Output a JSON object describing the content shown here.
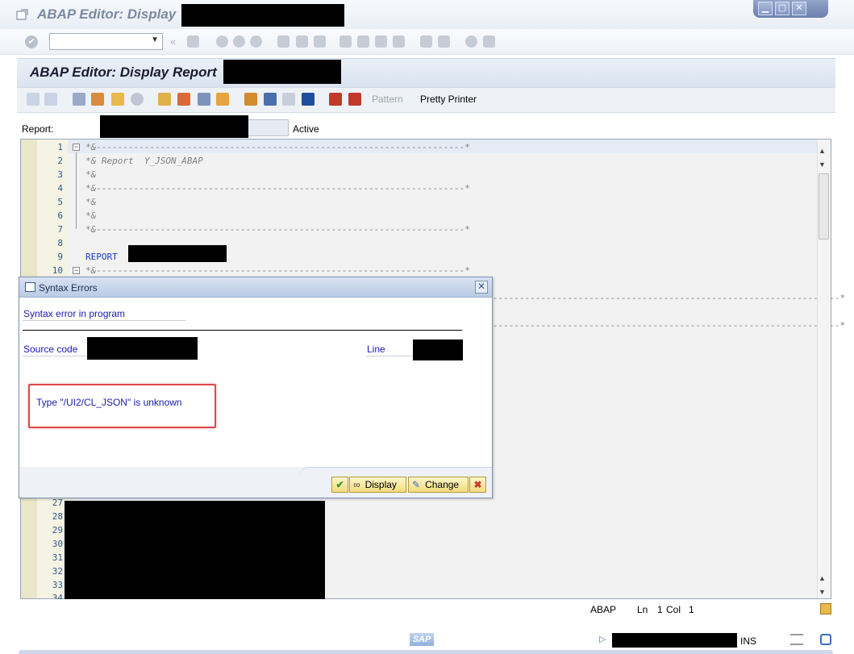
{
  "window": {
    "title": "ABAP Editor: Display",
    "buttons": [
      "▁",
      "▢",
      "✕"
    ]
  },
  "system_toolbar": {
    "command_field_value": ""
  },
  "screen": {
    "title": "ABAP Editor: Display Report"
  },
  "app_toolbar": {
    "pattern_label": "Pattern",
    "pretty_printer_label": "Pretty Printer"
  },
  "report_row": {
    "label": "Report:",
    "status": "Active"
  },
  "editor": {
    "lines": [
      {
        "num": "1",
        "text": "*&---------------------------------------------------------------------*"
      },
      {
        "num": "2",
        "text": "*& Report  Y_JSON_ABAP"
      },
      {
        "num": "3",
        "text": "*&"
      },
      {
        "num": "4",
        "text": "*&---------------------------------------------------------------------*"
      },
      {
        "num": "5",
        "text": "*&"
      },
      {
        "num": "6",
        "text": "*&"
      },
      {
        "num": "7",
        "text": "*&---------------------------------------------------------------------*"
      },
      {
        "num": "8",
        "text": ""
      },
      {
        "num": "9",
        "text": "REPORT"
      },
      {
        "num": "10",
        "text": "*&---------------------------------------------------------------------*"
      }
    ],
    "hidden_line_tail_1": "-----------------------------------------------------------------*",
    "hidden_line_tail_2": "-----------------------------------------------------------------*",
    "bottom_lines": [
      "27",
      "28",
      "29",
      "30",
      "31",
      "32",
      "33",
      "34"
    ]
  },
  "editor_status": {
    "language": "ABAP",
    "ln_label": "Ln",
    "ln_value": "1",
    "col_label": "Col",
    "col_value": "1"
  },
  "status_bar": {
    "sap_logo": "SAP",
    "mode": "INS"
  },
  "dialog": {
    "title": "Syntax Errors",
    "heading": "Syntax error in program",
    "source_code_label": "Source code",
    "line_label": "Line",
    "error_message": "Type \"/UI2/CL_JSON\" is unknown",
    "buttons": {
      "ok": "✔",
      "display": "Display",
      "change": "Change",
      "cancel": "✖"
    }
  }
}
